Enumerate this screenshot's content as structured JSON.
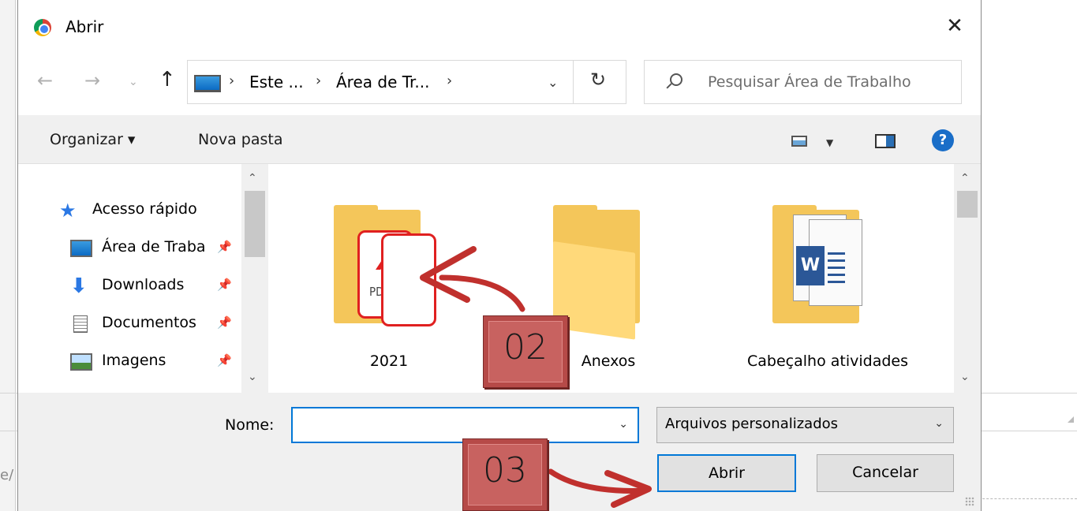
{
  "dialog": {
    "title": "Abrir",
    "close_glyph": "✕"
  },
  "nav": {
    "back": "←",
    "forward": "→",
    "recent": "⌄",
    "up": "↑"
  },
  "address": {
    "segments": [
      "Este ...",
      "Área de Tr..."
    ],
    "separator": "›",
    "dropdown": "⌄",
    "refresh": "↻"
  },
  "search": {
    "placeholder": "Pesquisar Área de Trabalho"
  },
  "toolbar": {
    "organize_label": "Organizar ▾",
    "new_folder_label": "Nova pasta",
    "view_dropdown": "▼",
    "help": "?"
  },
  "sidebar": {
    "items": [
      {
        "label": "Acesso rápido",
        "icon": "star-icon",
        "pinned": false
      },
      {
        "label": "Área de Traba",
        "icon": "desktop-icon",
        "pinned": true
      },
      {
        "label": "Downloads",
        "icon": "download-icon",
        "pinned": true
      },
      {
        "label": "Documentos",
        "icon": "document-icon",
        "pinned": true
      },
      {
        "label": "Imagens",
        "icon": "images-icon",
        "pinned": true
      }
    ],
    "pin_glyph": "📌",
    "scroll_up": "⌃",
    "scroll_down": "⌄"
  },
  "files": [
    {
      "name": "2021",
      "type": "folder",
      "preview": "pdf"
    },
    {
      "name": "Anexos",
      "type": "folder",
      "preview": "empty"
    },
    {
      "name": "Cabeçalho atividades",
      "type": "folder",
      "preview": "word"
    }
  ],
  "preview_text": {
    "pdf": "PDF",
    "word": "W"
  },
  "footer": {
    "name_label": "Nome:",
    "name_value": "",
    "name_dropdown": "⌄",
    "filetype_value": "Arquivos personalizados",
    "filetype_dropdown": "⌄",
    "open_button": "Abrir",
    "cancel_button": "Cancelar"
  },
  "annotations": {
    "step2": "02",
    "step3": "03",
    "color": "#c0302d"
  },
  "background": {
    "partial_text": "e/"
  },
  "colors": {
    "accent": "#0078d7",
    "folder": "#f4c65a",
    "badge": "#b64a48"
  }
}
